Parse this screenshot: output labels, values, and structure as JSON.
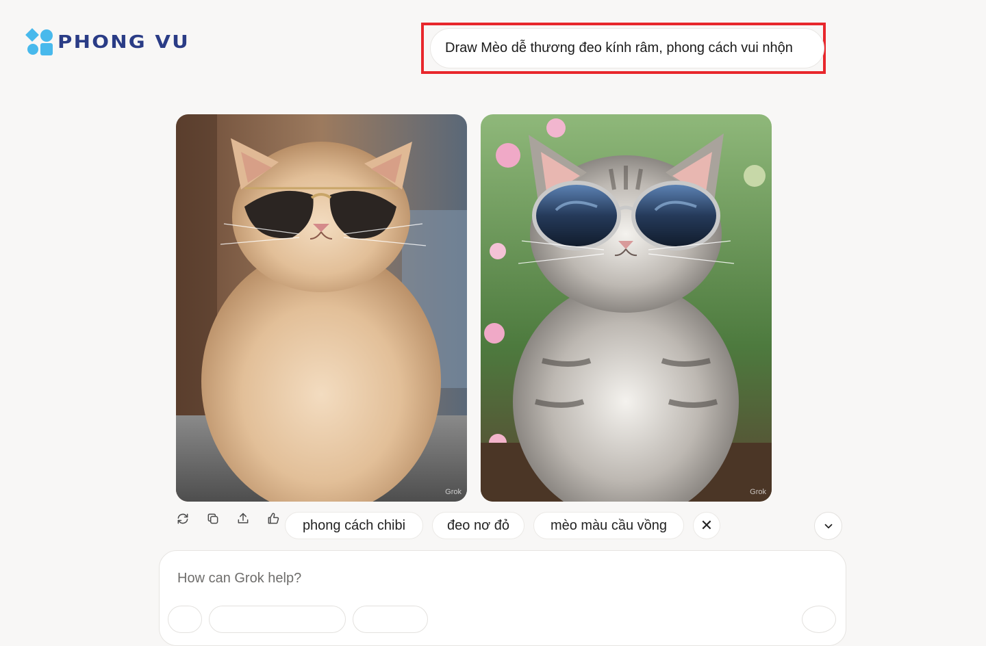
{
  "brand": {
    "logo_text": "PHONG VU",
    "accent": "#48b9ec",
    "text_color": "#2a3c86"
  },
  "prompt": {
    "text": "Draw Mèo dễ thương đeo kính râm, phong cách vui nhộn",
    "highlight_color": "#e8272c"
  },
  "images": [
    {
      "description_icon": "cat-sunglasses-image",
      "watermark": "Grok"
    },
    {
      "description_icon": "kitten-sunglasses-image",
      "watermark": "Grok"
    }
  ],
  "actions": [
    {
      "icon": "regenerate-icon"
    },
    {
      "icon": "copy-icon"
    },
    {
      "icon": "share-icon"
    },
    {
      "icon": "thumbs-up-icon"
    }
  ],
  "suggestions": [
    {
      "label": "phong cách chibi"
    },
    {
      "label": "đeo nơ đỏ"
    },
    {
      "label": "mèo màu cầu vồng"
    }
  ],
  "close_symbol": "✕",
  "composer": {
    "placeholder": "How can Grok help?"
  }
}
